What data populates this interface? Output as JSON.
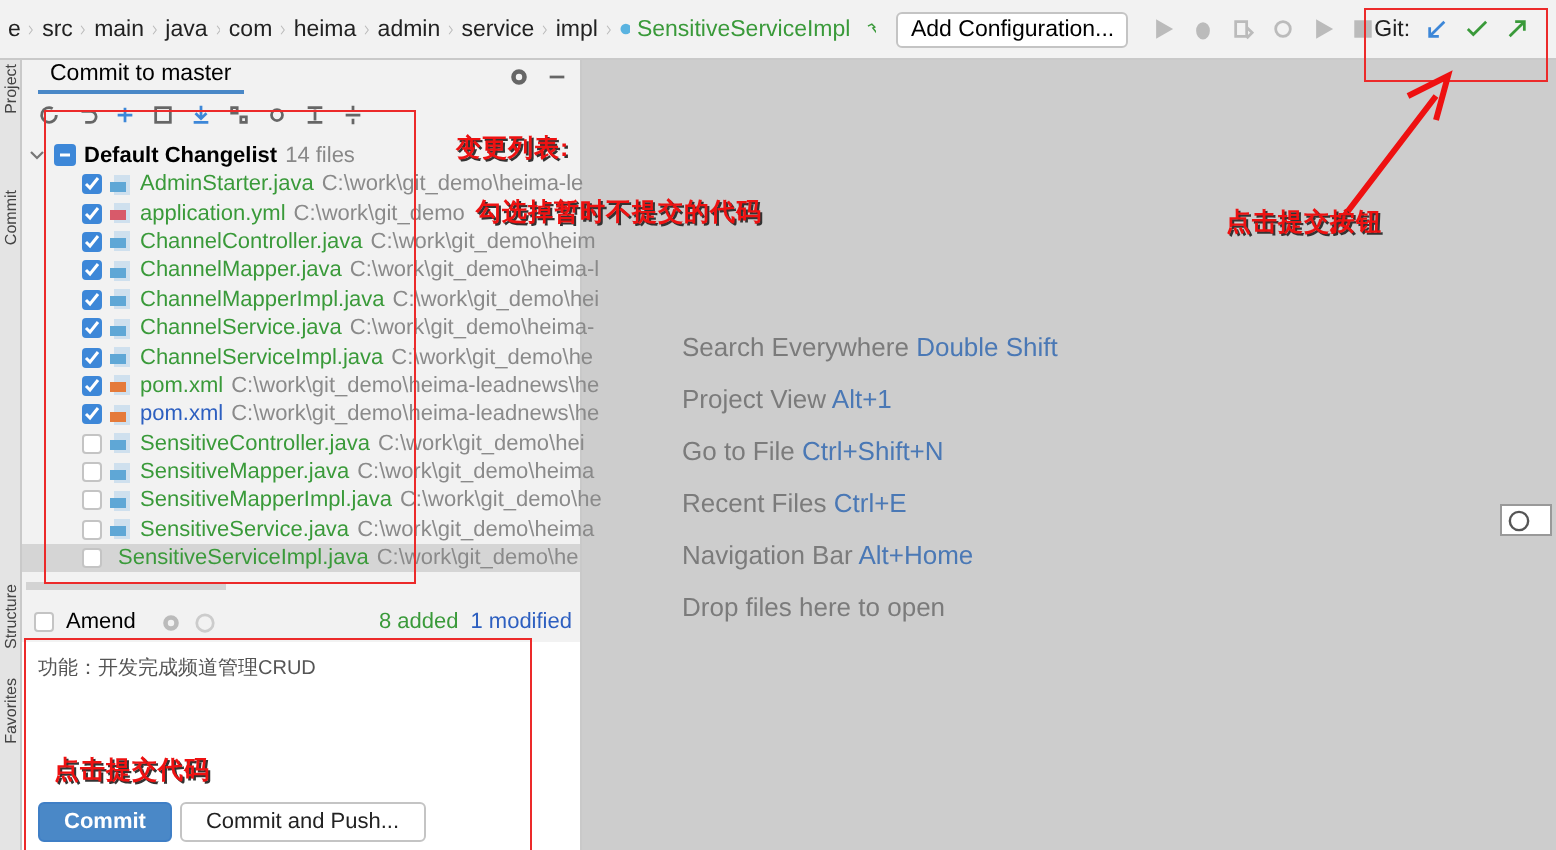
{
  "breadcrumbs": [
    "e",
    "src",
    "main",
    "java",
    "com",
    "heima",
    "admin",
    "service",
    "impl"
  ],
  "current_file": {
    "name": "SensitiveServiceImpl"
  },
  "run_config": {
    "label": "Add Configuration..."
  },
  "git": {
    "label": "Git:"
  },
  "side_tabs": [
    "Project",
    "Commit",
    "Structure",
    "Favorites"
  ],
  "commit_panel": {
    "tab": {
      "label": "Commit to master",
      "selected": true
    },
    "changelist": {
      "name": "Default Changelist",
      "count": "14 files",
      "expanded": true,
      "files": [
        {
          "name": "AdminStarter.java",
          "path": "C:\\work\\git_demo\\heima-le",
          "kind": "java",
          "modified": false,
          "checked": true,
          "selected": false
        },
        {
          "name": "application.yml",
          "path": "C:\\work\\git_demo",
          "kind": "yml",
          "modified": false,
          "checked": true,
          "selected": false
        },
        {
          "name": "ChannelController.java",
          "path": "C:\\work\\git_demo\\heim",
          "kind": "java",
          "modified": false,
          "checked": true,
          "selected": false
        },
        {
          "name": "ChannelMapper.java",
          "path": "C:\\work\\git_demo\\heima-l",
          "kind": "java",
          "modified": false,
          "checked": true,
          "selected": false
        },
        {
          "name": "ChannelMapperImpl.java",
          "path": "C:\\work\\git_demo\\hei",
          "kind": "java",
          "modified": false,
          "checked": true,
          "selected": false
        },
        {
          "name": "ChannelService.java",
          "path": "C:\\work\\git_demo\\heima-",
          "kind": "java",
          "modified": false,
          "checked": true,
          "selected": false
        },
        {
          "name": "ChannelServiceImpl.java",
          "path": "C:\\work\\git_demo\\he",
          "kind": "java",
          "modified": false,
          "checked": true,
          "selected": false
        },
        {
          "name": "pom.xml",
          "path": "C:\\work\\git_demo\\heima-leadnews\\he",
          "kind": "xml",
          "modified": false,
          "checked": true,
          "selected": false
        },
        {
          "name": "pom.xml",
          "path": "C:\\work\\git_demo\\heima-leadnews\\he",
          "kind": "xml",
          "modified": true,
          "checked": true,
          "selected": false
        },
        {
          "name": "SensitiveController.java",
          "path": "C:\\work\\git_demo\\hei",
          "kind": "java",
          "modified": false,
          "checked": false,
          "selected": false
        },
        {
          "name": "SensitiveMapper.java",
          "path": "C:\\work\\git_demo\\heima",
          "kind": "java",
          "modified": false,
          "checked": false,
          "selected": false
        },
        {
          "name": "SensitiveMapperImpl.java",
          "path": "C:\\work\\git_demo\\he",
          "kind": "java",
          "modified": false,
          "checked": false,
          "selected": false
        },
        {
          "name": "SensitiveService.java",
          "path": "C:\\work\\git_demo\\heima",
          "kind": "java",
          "modified": false,
          "checked": false,
          "selected": false
        },
        {
          "name": "SensitiveServiceImpl.java",
          "path": "C:\\work\\git_demo\\he",
          "kind": "java",
          "modified": false,
          "checked": false,
          "selected": true
        }
      ]
    },
    "amend": {
      "label": "Amend",
      "checked": false
    },
    "summary": [
      {
        "text": "8 added",
        "kind": "added"
      },
      {
        "text": "1 modified",
        "kind": "modified"
      }
    ],
    "message": "功能：开发完成频道管理CRUD",
    "buttons": [
      {
        "label": "Commit",
        "kind": "primary"
      },
      {
        "label": "Commit and Push...",
        "kind": "secondary"
      }
    ]
  },
  "editor_hints": [
    {
      "label": "Search Everywhere",
      "shortcut": "Double Shift"
    },
    {
      "label": "Project View",
      "shortcut": "Alt+1"
    },
    {
      "label": "Go to File",
      "shortcut": "Ctrl+Shift+N"
    },
    {
      "label": "Recent Files",
      "shortcut": "Ctrl+E"
    },
    {
      "label": "Navigation Bar",
      "shortcut": "Alt+Home"
    },
    {
      "label": "Drop files here to open"
    }
  ],
  "annotations": [
    {
      "text": "变更列表:"
    },
    {
      "text": "勾选掉暂时不提交的代码"
    },
    {
      "text": "点击提交按钮"
    },
    {
      "text": "点击提交代码"
    }
  ]
}
